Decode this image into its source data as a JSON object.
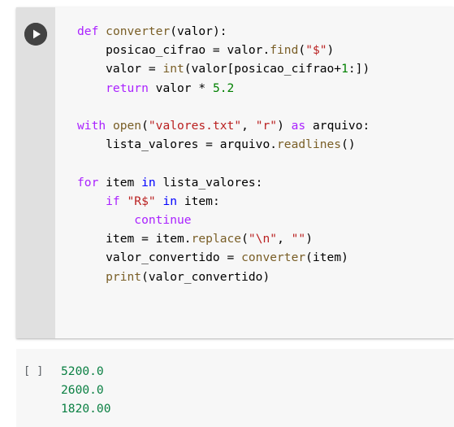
{
  "cell": {
    "run_button": {
      "icon": "play-icon",
      "tooltip": "Run cell"
    },
    "language": "python",
    "code_lines": [
      [
        {
          "t": "def ",
          "c": "kw2"
        },
        {
          "t": "converter",
          "c": "fn"
        },
        {
          "t": "(valor):",
          "c": "plain"
        }
      ],
      [
        {
          "t": "    posicao_cifrao = valor.",
          "c": "plain"
        },
        {
          "t": "find",
          "c": "fn"
        },
        {
          "t": "(",
          "c": "plain"
        },
        {
          "t": "\"$\"",
          "c": "str"
        },
        {
          "t": ")",
          "c": "plain"
        }
      ],
      [
        {
          "t": "    valor = ",
          "c": "plain"
        },
        {
          "t": "int",
          "c": "fn"
        },
        {
          "t": "(valor[posicao_cifrao+",
          "c": "plain"
        },
        {
          "t": "1",
          "c": "num"
        },
        {
          "t": ":])",
          "c": "plain"
        }
      ],
      [
        {
          "t": "    return",
          "c": "kw2"
        },
        {
          "t": " valor * ",
          "c": "plain"
        },
        {
          "t": "5.2",
          "c": "num"
        }
      ],
      [],
      [
        {
          "t": "with ",
          "c": "kw2"
        },
        {
          "t": "open",
          "c": "fn"
        },
        {
          "t": "(",
          "c": "plain"
        },
        {
          "t": "\"valores.txt\"",
          "c": "str"
        },
        {
          "t": ", ",
          "c": "plain"
        },
        {
          "t": "\"r\"",
          "c": "str"
        },
        {
          "t": ") ",
          "c": "plain"
        },
        {
          "t": "as",
          "c": "kw2"
        },
        {
          "t": " arquivo:",
          "c": "plain"
        }
      ],
      [
        {
          "t": "    lista_valores = arquivo.",
          "c": "plain"
        },
        {
          "t": "readlines",
          "c": "fn"
        },
        {
          "t": "()",
          "c": "plain"
        }
      ],
      [],
      [
        {
          "t": "for ",
          "c": "kw2"
        },
        {
          "t": "item ",
          "c": "plain"
        },
        {
          "t": "in",
          "c": "kw"
        },
        {
          "t": " lista_valores:",
          "c": "plain"
        }
      ],
      [
        {
          "t": "    if ",
          "c": "kw2"
        },
        {
          "t": "\"R$\"",
          "c": "str"
        },
        {
          "t": " in",
          "c": "kw"
        },
        {
          "t": " item:",
          "c": "plain"
        }
      ],
      [
        {
          "t": "        continue",
          "c": "kw2"
        }
      ],
      [
        {
          "t": "    item = item.",
          "c": "plain"
        },
        {
          "t": "replace",
          "c": "fn"
        },
        {
          "t": "(",
          "c": "plain"
        },
        {
          "t": "\"\\n\"",
          "c": "str"
        },
        {
          "t": ", ",
          "c": "plain"
        },
        {
          "t": "\"\"",
          "c": "str"
        },
        {
          "t": ")",
          "c": "plain"
        }
      ],
      [
        {
          "t": "    valor_convertido = ",
          "c": "plain"
        },
        {
          "t": "converter",
          "c": "fn"
        },
        {
          "t": "(item)",
          "c": "plain"
        }
      ],
      [
        {
          "t": "    print",
          "c": "fn"
        },
        {
          "t": "(valor_convertido)",
          "c": "plain"
        }
      ]
    ]
  },
  "output": {
    "prompt": "[ ]",
    "lines": [
      "5200.0",
      "2600.0",
      "1820.00"
    ],
    "text_color": "#0b8043"
  },
  "colors": {
    "cell_background": "#f7f7f7",
    "gutter_background": "#e0e0e0",
    "run_button": "#434343",
    "keyword": "#aa22ff",
    "keyword_in": "#0000ff",
    "function": "#795e26",
    "string": "#ba2121",
    "number": "#008000",
    "plain_text": "#000000",
    "output_green": "#0b8043",
    "page_background": "#ffffff"
  }
}
